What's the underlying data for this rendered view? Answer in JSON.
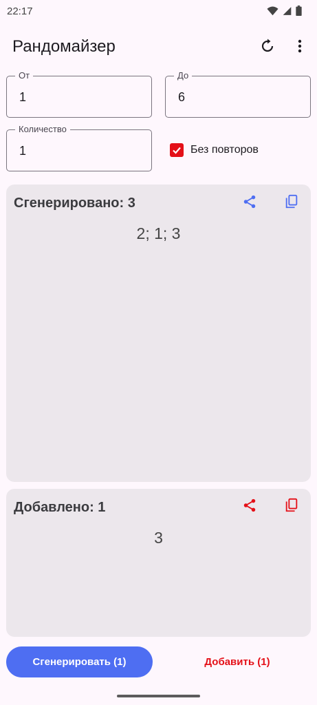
{
  "status_bar": {
    "time": "22:17"
  },
  "app_bar": {
    "title": "Рандомайзер",
    "reset_icon": "refresh-icon",
    "menu_icon": "more-vert-icon"
  },
  "form": {
    "from": {
      "label": "От",
      "value": "1"
    },
    "to": {
      "label": "До",
      "value": "6"
    },
    "count": {
      "label": "Количество",
      "value": "1"
    },
    "no_repeats": {
      "label": "Без повторов",
      "checked": true
    }
  },
  "generated_card": {
    "title": "Сгенерировано: 3",
    "values": "2; 1; 3",
    "accent": "#4e6ef2"
  },
  "added_card": {
    "title": "Добавлено: 1",
    "values": "3",
    "accent": "#e41018"
  },
  "actions": {
    "generate_label": "Сгенерировать (1)",
    "add_label": "Добавить (1)"
  }
}
